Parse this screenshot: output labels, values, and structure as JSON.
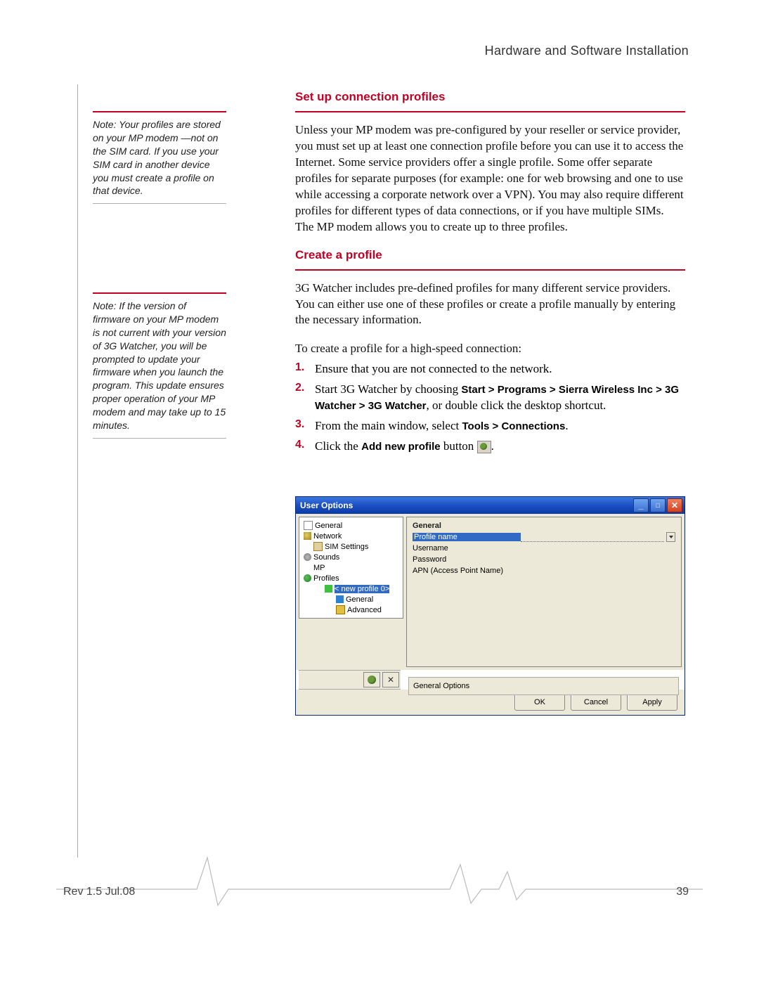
{
  "header": {
    "right": "Hardware and Software Installation"
  },
  "sidenotes": {
    "n1": "Note: Your profiles are stored on your MP modem —not on the SIM card. If you use your SIM card in another device you must create a profile on that device.",
    "n2": "Note: If the version of firmware on your MP modem is not current with your version of 3G Watcher, you will be prompted to update your firmware when you launch the program. This update ensures proper operation of your MP modem and may take up to 15 minutes."
  },
  "sections": {
    "h1": "Set up connection profiles",
    "p1": "Unless your MP modem was pre-configured by your reseller or service provider, you must set up at least one connection profile before you can use it to access the Internet. Some service providers offer a single profile. Some offer separate profiles for separate purposes (for example: one for web browsing and one to use while accessing a corporate network over a VPN). You may also require different profiles for different types of data connections, or if you have multiple SIMs. The MP modem allows you to create up to three profiles.",
    "h2": "Create a profile",
    "p2": "3G Watcher includes pre-defined profiles for many different service providers. You can either use one of these profiles or create a profile manually by entering the necessary information.",
    "p3": "To create a profile for a high-speed connection:",
    "steps": [
      {
        "n": "1.",
        "t": "Ensure that you are not connected to the network."
      },
      {
        "n": "2.",
        "t_pre": "Start 3G Watcher by choosing ",
        "t_b1": "Start > Programs > Sierra Wireless Inc > 3G Watcher > 3G Watcher",
        "t_post": ", or double click the desktop shortcut."
      },
      {
        "n": "3.",
        "t_pre": "From the main window, select ",
        "t_b1": "Tools > Connections",
        "t_post": "."
      },
      {
        "n": "4.",
        "t_pre": "Click the ",
        "t_b1": "Add new profile",
        "t_post": " button ",
        "icon": "add-profile-icon",
        "t_end": "."
      }
    ]
  },
  "window": {
    "title": "User Options",
    "tree": {
      "items": [
        "General",
        "Network",
        "SIM Settings",
        "Sounds",
        "MP",
        "Profiles",
        "< new profile 0>",
        "General",
        "Advanced"
      ]
    },
    "panel": {
      "group": "General",
      "rows": [
        "Profile name",
        "Username",
        "Password",
        "APN (Access Point Name)"
      ]
    },
    "generalOptions": "General Options",
    "buttons": {
      "ok": "OK",
      "cancel": "Cancel",
      "apply": "Apply"
    }
  },
  "footer": {
    "rev": "Rev 1.5  Jul.08",
    "page": "39"
  }
}
